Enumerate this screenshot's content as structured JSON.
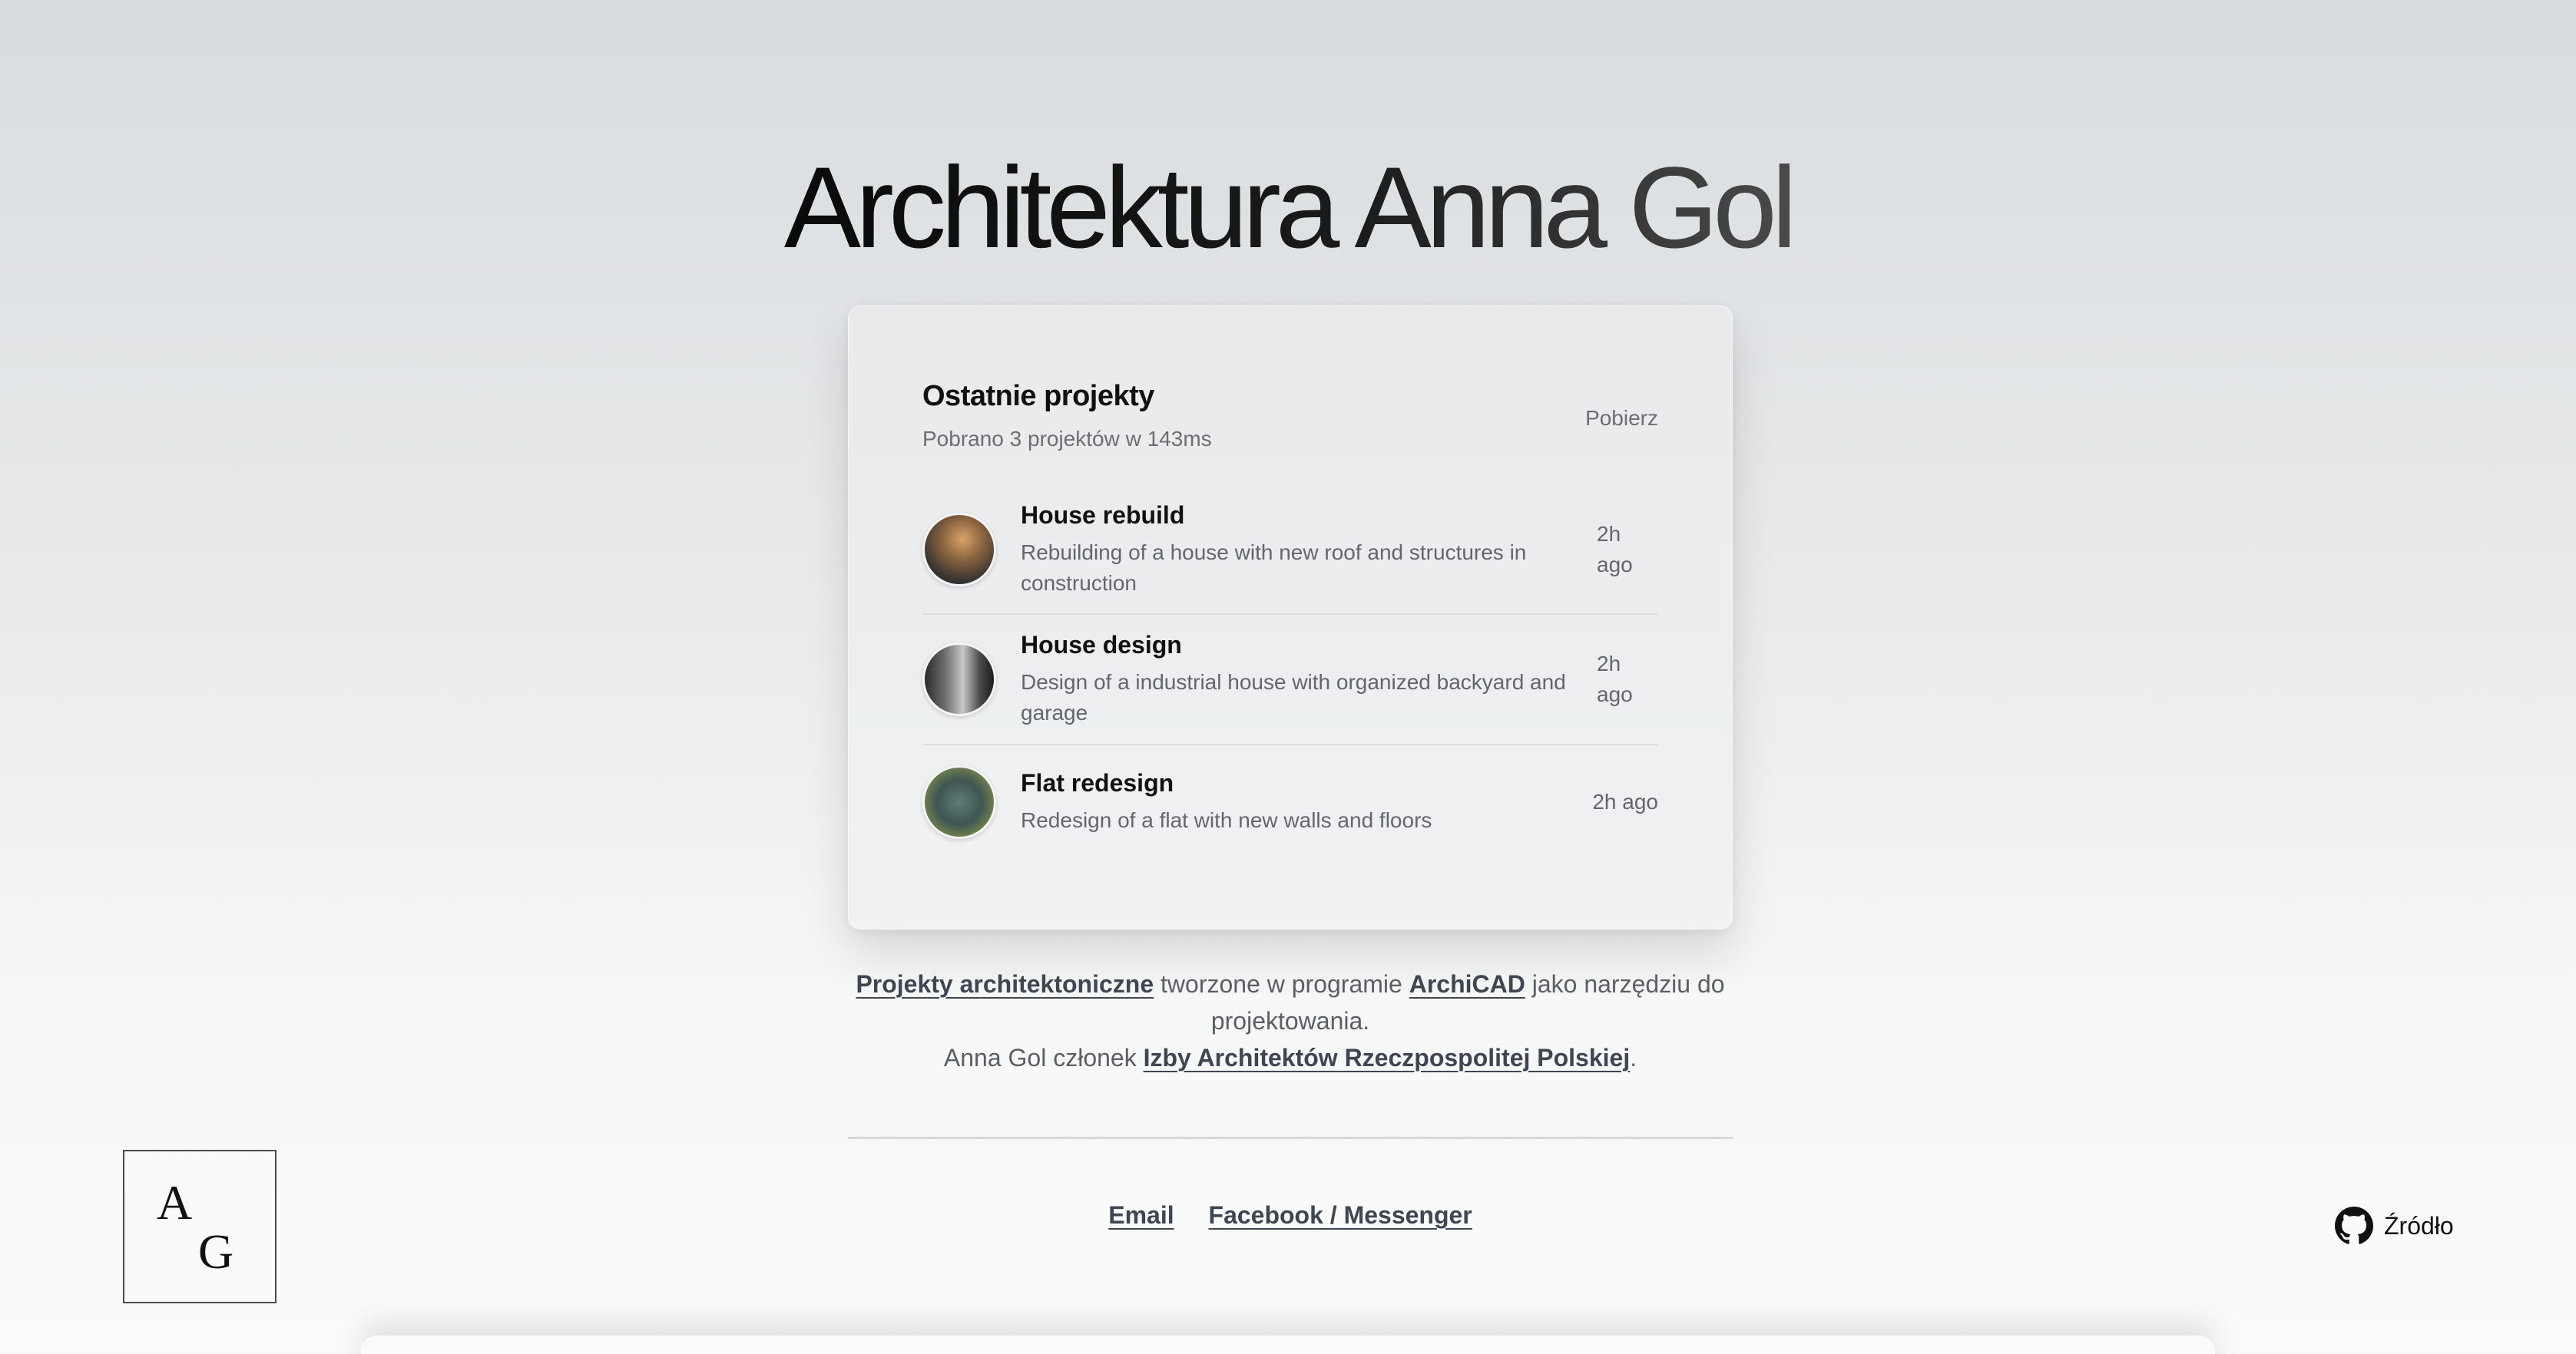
{
  "page_title": "Architektura Anna Gol",
  "card": {
    "title": "Ostatnie projekty",
    "subtitle": "Pobrano 3 projektów w 143ms",
    "download_label": "Pobierz",
    "projects": [
      {
        "title": "House rebuild",
        "description": "Rebuilding of a house with new roof and structures in construction",
        "time": "2h ago"
      },
      {
        "title": "House design",
        "description": "Design of a industrial house with organized backyard and garage",
        "time": "2h ago"
      },
      {
        "title": "Flat redesign",
        "description": "Redesign of a flat with new walls and floors",
        "time": "2h ago"
      }
    ]
  },
  "description": {
    "link1": "Projekty architektoniczne",
    "text1": " tworzone w programie ",
    "link2": "ArchiCAD",
    "text2": " jako narzędziu do projektowania.",
    "text3": "Anna Gol członek ",
    "link3": "Izby Architektów Rzeczpospolitej Polskiej",
    "text4": "."
  },
  "footer": {
    "email": "Email",
    "facebook": "Facebook / Messenger"
  },
  "logo": {
    "letter1": "A",
    "letter2": "G"
  },
  "source": {
    "label": "Źródło",
    "icon": "github-icon"
  }
}
